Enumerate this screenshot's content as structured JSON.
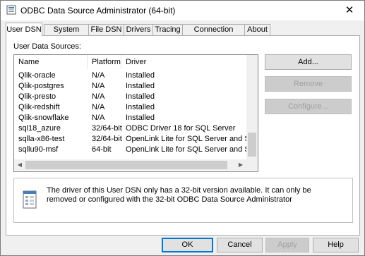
{
  "window": {
    "title": "ODBC Data Source Administrator (64-bit)",
    "close_glyph": "✕",
    "app_icon": "odbc-admin-icon"
  },
  "tabs": [
    {
      "label": "User DSN",
      "active": true
    },
    {
      "label": "System DSN"
    },
    {
      "label": "File DSN"
    },
    {
      "label": "Drivers"
    },
    {
      "label": "Tracing"
    },
    {
      "label": "Connection Pooling"
    },
    {
      "label": "About"
    }
  ],
  "user_dsn": {
    "section_label": "User Data Sources:",
    "columns": {
      "name": "Name",
      "platform": "Platform",
      "driver": "Driver"
    },
    "rows": [
      {
        "name": "Qlik-oracle",
        "platform": "N/A",
        "driver": "Installed"
      },
      {
        "name": "Qlik-postgres",
        "platform": "N/A",
        "driver": "Installed"
      },
      {
        "name": "Qlik-presto",
        "platform": "N/A",
        "driver": "Installed"
      },
      {
        "name": "Qlik-redshift",
        "platform": "N/A",
        "driver": "Installed"
      },
      {
        "name": "Qlik-snowflake",
        "platform": "N/A",
        "driver": "Installed"
      },
      {
        "name": "sql18_azure",
        "platform": "32/64-bit",
        "driver": "ODBC Driver 18 for SQL Server"
      },
      {
        "name": "sqlla-x86-test",
        "platform": "32/64-bit",
        "driver": "OpenLink Lite for SQL Server and Sybase"
      },
      {
        "name": "sqllu90-msf",
        "platform": "64-bit",
        "driver": "OpenLink Lite for SQL Server and Sybase"
      }
    ],
    "buttons": {
      "add": "Add...",
      "remove": "Remove",
      "configure": "Configure..."
    },
    "info_text": "The driver of this User DSN only has a 32-bit version available. It can only be removed or configured with the 32-bit ODBC Data Source Administrator"
  },
  "footer": {
    "ok": "OK",
    "cancel": "Cancel",
    "apply": "Apply",
    "help": "Help"
  },
  "colors": {
    "accent": "#0078d7",
    "disabled_text": "#a0a0a0"
  }
}
